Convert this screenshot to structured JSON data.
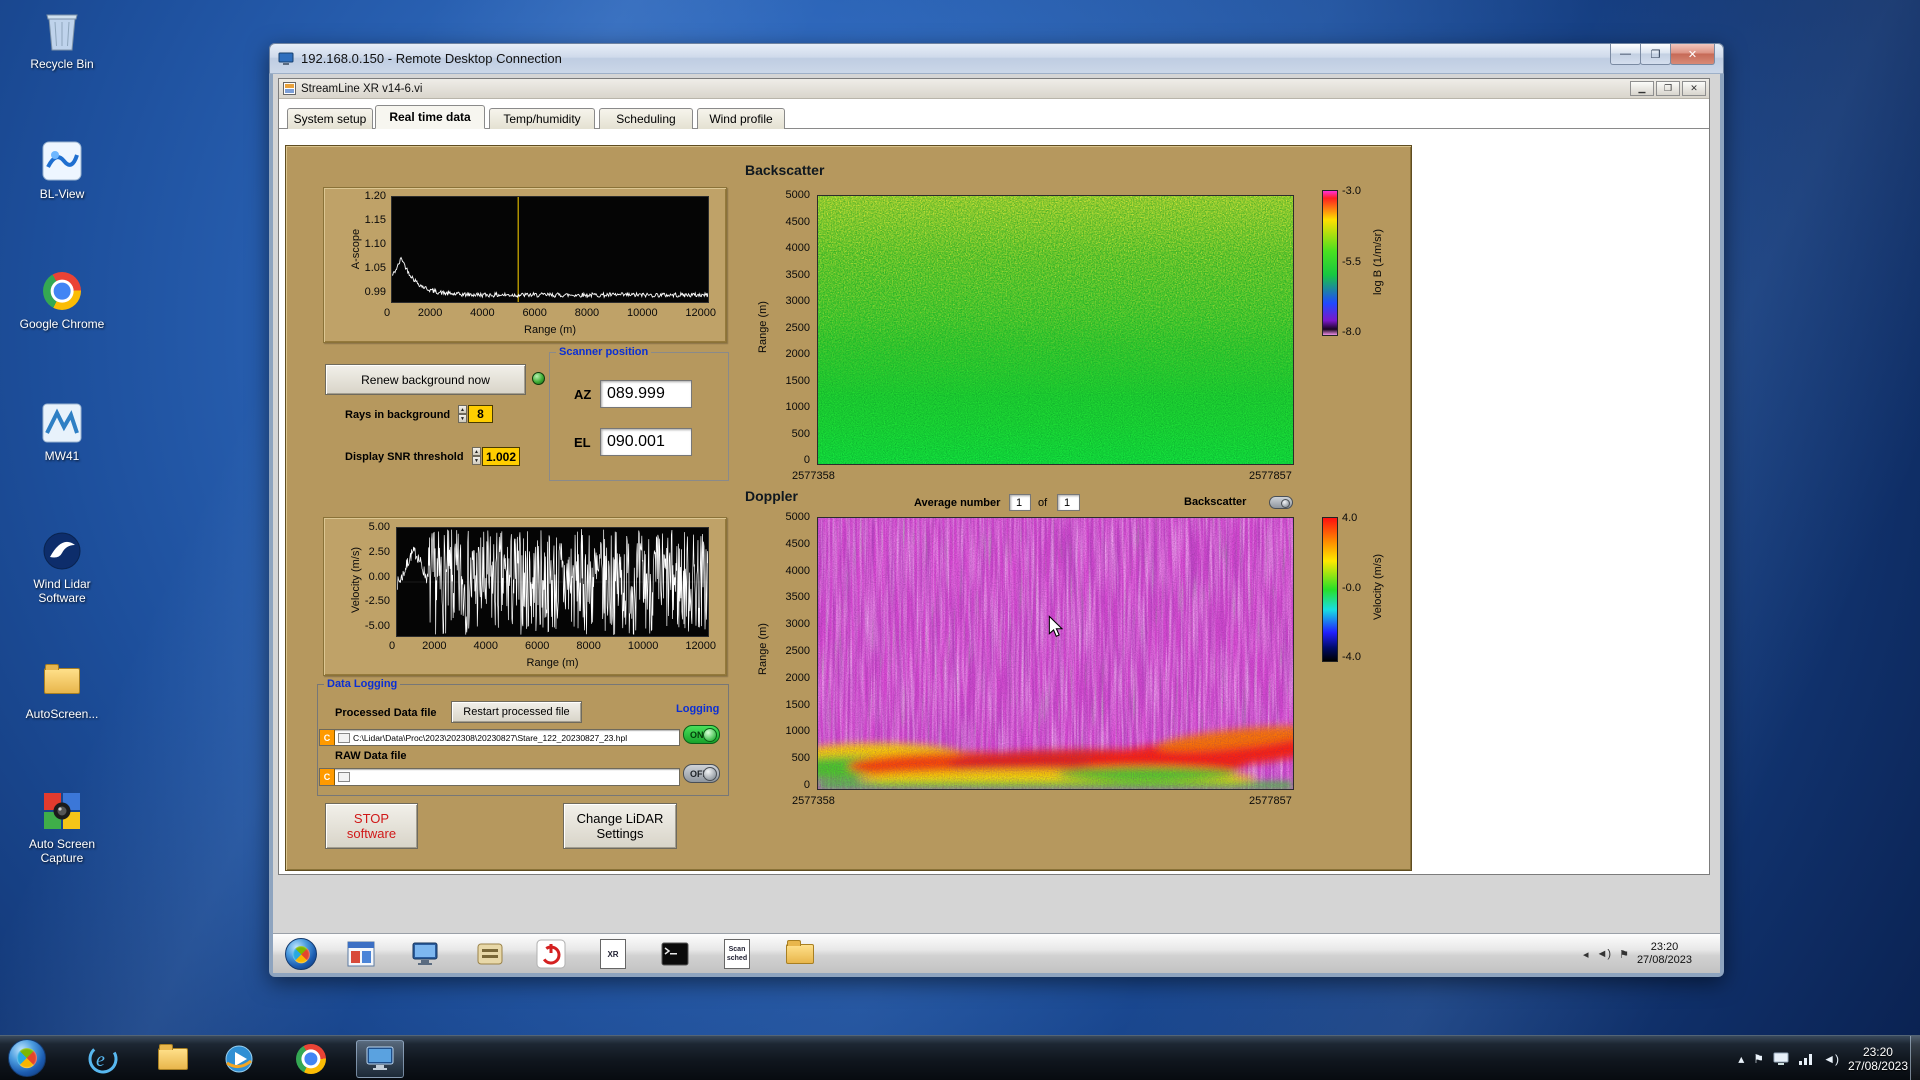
{
  "desktop": {
    "icons": [
      {
        "label": "Recycle Bin"
      },
      {
        "label": "BL-View"
      },
      {
        "label": "Google Chrome"
      },
      {
        "label": "MW41"
      },
      {
        "label": "Wind Lidar Software"
      },
      {
        "label": "AutoScreen..."
      },
      {
        "label": "Auto Screen Capture"
      }
    ]
  },
  "rdp": {
    "title": "192.168.0.150 - Remote Desktop Connection",
    "min_glyph": "—",
    "max_glyph": "❐",
    "close_glyph": "✕"
  },
  "app": {
    "title": "StreamLine XR v14-6.vi",
    "tabs": [
      {
        "label": "System setup"
      },
      {
        "label": "Real time data"
      },
      {
        "label": "Temp/humidity"
      },
      {
        "label": "Scheduling"
      },
      {
        "label": "Wind profile"
      }
    ],
    "ascope": {
      "ylabel": "A-scope",
      "yticks": [
        "1.20",
        "1.15",
        "1.10",
        "1.05",
        "0.99"
      ],
      "xticks": [
        "0",
        "2000",
        "4000",
        "6000",
        "8000",
        "10000",
        "12000"
      ],
      "xlabel": "Range (m)"
    },
    "controls": {
      "renew_label": "Renew background now",
      "rays_label": "Rays in background",
      "rays_value": "8",
      "snr_label": "Display SNR threshold",
      "snr_value": "1.002"
    },
    "scanner": {
      "title": "Scanner position",
      "az_label": "AZ",
      "az_value": "089.999",
      "el_label": "EL",
      "el_value": "090.001"
    },
    "backscatter": {
      "title": "Backscatter",
      "ylabel": "Range (m)",
      "yticks": [
        "5000",
        "4500",
        "4000",
        "3500",
        "3000",
        "2500",
        "2000",
        "1500",
        "1000",
        "500",
        "0"
      ],
      "x_left": "2577358",
      "x_right": "2577857",
      "cb_ticks": [
        "-3.0",
        "-5.5",
        "-8.0"
      ],
      "cb_label": "log B (1/m/sr)"
    },
    "doppler": {
      "title": "Doppler",
      "avg_label": "Average number",
      "avg_value": "1",
      "of_label": "of",
      "avg_total": "1",
      "bs_toggle_label": "Backscatter",
      "ylabel": "Range (m)",
      "yticks": [
        "5000",
        "4500",
        "4000",
        "3500",
        "3000",
        "2500",
        "2000",
        "1500",
        "1000",
        "500",
        "0"
      ],
      "x_left": "2577358",
      "x_right": "2577857",
      "cb_ticks": [
        "4.0",
        "-0.0",
        "-4.0"
      ],
      "cb_label": "Velocity (m/s)"
    },
    "velocity": {
      "ylabel": "Velocity (m/s)",
      "yticks": [
        "5.00",
        "2.50",
        "0.00",
        "-2.50",
        "-5.00"
      ],
      "xticks": [
        "0",
        "2000",
        "4000",
        "6000",
        "8000",
        "10000",
        "12000"
      ],
      "xlabel": "Range (m)"
    },
    "logging": {
      "title": "Data Logging",
      "processed_label": "Processed Data file",
      "restart_btn": "Restart processed file",
      "logging_label": "Logging",
      "drive_letter": "C",
      "processed_path": "C:\\Lidar\\Data\\Proc\\2023\\202308\\20230827\\Stare_122_20230827_23.hpl",
      "on_label": "ON",
      "raw_label": "RAW Data file",
      "raw_path": "",
      "off_label": "OFF"
    },
    "stop_btn_line1": "STOP",
    "stop_btn_line2": "software",
    "settings_btn_line1": "Change LiDAR",
    "settings_btn_line2": "Settings"
  },
  "remote_taskbar": {
    "xr_label": "XR",
    "scan_label": "Scan",
    "sched_label": "sched",
    "clock_time": "23:20",
    "clock_date": "27/08/2023"
  },
  "host_taskbar": {
    "clock_time": "23:20",
    "clock_date": "27/08/2023"
  }
}
